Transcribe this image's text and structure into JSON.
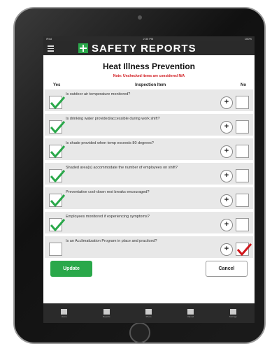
{
  "status": {
    "left": "iPad",
    "time": "2:30 PM",
    "right": "100%"
  },
  "app": {
    "brand": "SAFETY REPORTS",
    "accent": "#2aa84a"
  },
  "form": {
    "title": "Heat Illness Prevention",
    "note": "Note: Unchecked items are considered N/A",
    "col_yes": "Yes",
    "col_item": "Inspection Item",
    "col_no": "No",
    "add_symbol": "+",
    "items": [
      {
        "text": "Is outdoor air temperature monitored?",
        "yes": true,
        "no": false
      },
      {
        "text": "Is drinking water provided/accessible during work shift?",
        "yes": true,
        "no": false
      },
      {
        "text": "Is shade provided when temp exceeds 80 degrees?",
        "yes": true,
        "no": false
      },
      {
        "text": "Shaded area(s) accommodate the number of employees on shift?",
        "yes": true,
        "no": false
      },
      {
        "text": "Preventative cool-down rest breaks encouraged?",
        "yes": true,
        "no": false
      },
      {
        "text": "Employees monitored if experiencing symptoms?",
        "yes": true,
        "no": false
      },
      {
        "text": "Is an Acclimatization Program in place and practiced?",
        "yes": false,
        "no": true
      }
    ]
  },
  "actions": {
    "update": "Update",
    "cancel": "Cancel"
  },
  "tabs": [
    {
      "label": "Home",
      "icon": "home-icon"
    },
    {
      "label": "Reports",
      "icon": "reports-icon"
    },
    {
      "label": "Photo",
      "icon": "camera-icon"
    },
    {
      "label": "Upload",
      "icon": "upload-icon"
    },
    {
      "label": "Settings",
      "icon": "settings-icon"
    }
  ]
}
